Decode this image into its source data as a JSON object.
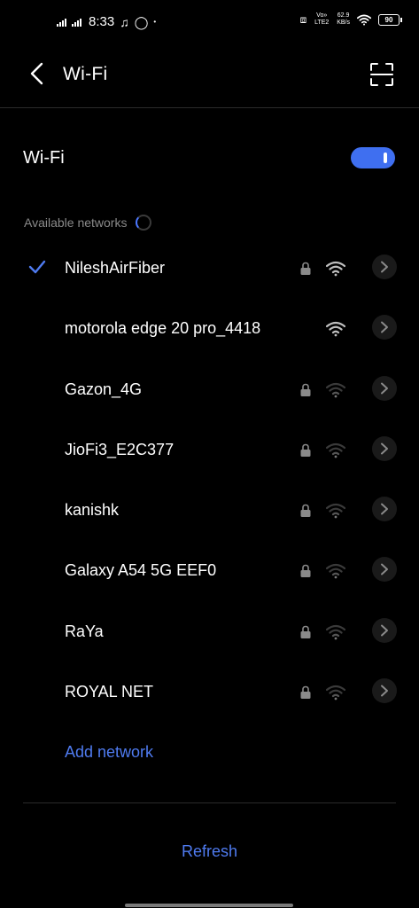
{
  "status_bar": {
    "time": "8:33",
    "volte": "Vo» LTE2",
    "speed_value": "62.9",
    "speed_unit": "KB/s",
    "battery": "90"
  },
  "header": {
    "title": "Wi-Fi"
  },
  "wifi_toggle": {
    "label": "Wi-Fi",
    "state": "on",
    "accent": "#3f6ff0"
  },
  "available_label": "Available networks",
  "networks": [
    {
      "name": "NileshAirFiber",
      "connected": true,
      "locked": true,
      "signal": "strong"
    },
    {
      "name": "motorola edge 20 pro_4418",
      "connected": false,
      "locked": false,
      "signal": "strong"
    },
    {
      "name": "Gazon_4G",
      "connected": false,
      "locked": true,
      "signal": "weak"
    },
    {
      "name": "JioFi3_E2C377",
      "connected": false,
      "locked": true,
      "signal": "weak"
    },
    {
      "name": "kanishk",
      "connected": false,
      "locked": true,
      "signal": "weak"
    },
    {
      "name": "Galaxy A54 5G EEF0",
      "connected": false,
      "locked": true,
      "signal": "weak"
    },
    {
      "name": "RaYa",
      "connected": false,
      "locked": true,
      "signal": "weak"
    },
    {
      "name": "ROYAL NET",
      "connected": false,
      "locked": true,
      "signal": "weak"
    }
  ],
  "add_network_label": "Add network",
  "refresh_label": "Refresh",
  "colors": {
    "background": "#000000",
    "link": "#4f7bf0",
    "muted": "#8a8a8a"
  }
}
